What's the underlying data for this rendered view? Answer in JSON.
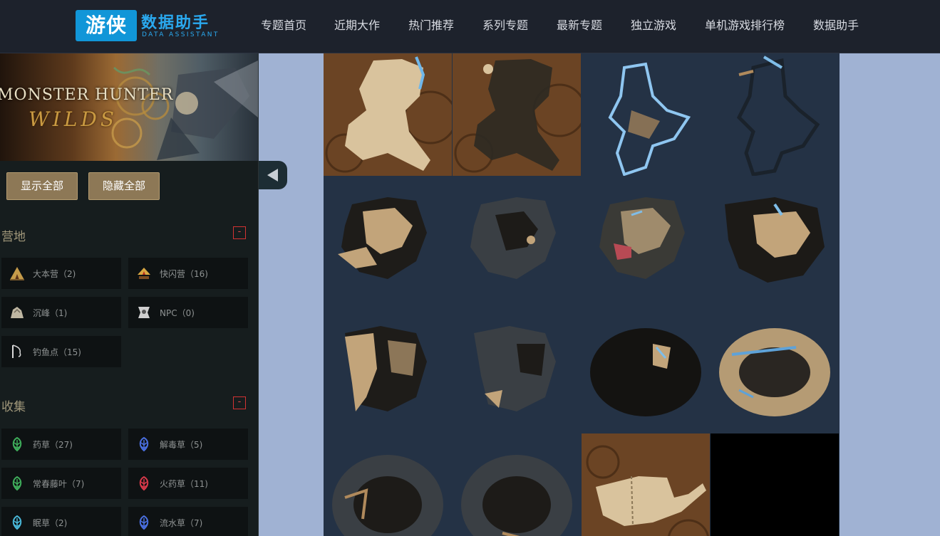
{
  "header": {
    "logo_badge": "游侠",
    "logo_title": "数据助手",
    "logo_subtitle": "DATA ASSISTANT",
    "nav": [
      "专题首页",
      "近期大作",
      "热门推荐",
      "系列专题",
      "最新专题",
      "独立游戏",
      "单机游戏排行榜",
      "数据助手"
    ]
  },
  "banner": {
    "title": "MONSTER HUNTER",
    "subtitle": "WILDS"
  },
  "actions": {
    "show_all": "显示全部",
    "hide_all": "隐藏全部"
  },
  "sections": [
    {
      "title": "营地",
      "collapse": "-",
      "items": [
        {
          "label": "大本营（2)",
          "icon": "tent-icon"
        },
        {
          "label": "快闪营（16)",
          "icon": "campfire-icon"
        },
        {
          "label": "沉峰（1)",
          "icon": "rock-icon"
        },
        {
          "label": "NPC（0)",
          "icon": "npc-icon"
        },
        {
          "label": "钓鱼点（15)",
          "icon": "fishing-rod-icon"
        }
      ]
    },
    {
      "title": "收集",
      "collapse": "-",
      "items": [
        {
          "label": "药草（27)",
          "icon": "herb-green-icon"
        },
        {
          "label": "解毒草（5)",
          "icon": "herb-blue-icon"
        },
        {
          "label": "常春藤叶（7)",
          "icon": "herb-green-icon"
        },
        {
          "label": "火药草（11)",
          "icon": "herb-red-icon"
        },
        {
          "label": "眠草（2)",
          "icon": "herb-cyan-icon"
        },
        {
          "label": "流水草（7)",
          "icon": "herb-blue-icon"
        }
      ]
    }
  ],
  "colors": {
    "header_bg": "#1d222c",
    "logo_blue": "#1196d8",
    "button_gold": "#8d7856",
    "page_bg": "#a0b2d3",
    "map_bg": "#243245"
  },
  "map_tiles": [
    {
      "name": "map-tile-1",
      "style": "parchment-light"
    },
    {
      "name": "map-tile-2",
      "style": "parchment-dark"
    },
    {
      "name": "map-tile-3",
      "style": "blue-outline"
    },
    {
      "name": "map-tile-4",
      "style": "dark-outline"
    },
    {
      "name": "map-tile-5",
      "style": "tan-cave"
    },
    {
      "name": "map-tile-6",
      "style": "dark-cave"
    },
    {
      "name": "map-tile-7",
      "style": "tan-cave-red"
    },
    {
      "name": "map-tile-8",
      "style": "tan-cave-blue"
    },
    {
      "name": "map-tile-9",
      "style": "tan-cave"
    },
    {
      "name": "map-tile-10",
      "style": "dark-cave"
    },
    {
      "name": "map-tile-11",
      "style": "dark-mass"
    },
    {
      "name": "map-tile-12",
      "style": "tan-ring"
    },
    {
      "name": "map-tile-13",
      "style": "dark-ring"
    },
    {
      "name": "map-tile-14",
      "style": "dark-ring"
    },
    {
      "name": "map-tile-15",
      "style": "parchment-island"
    },
    {
      "name": "map-tile-16",
      "style": "empty"
    }
  ]
}
